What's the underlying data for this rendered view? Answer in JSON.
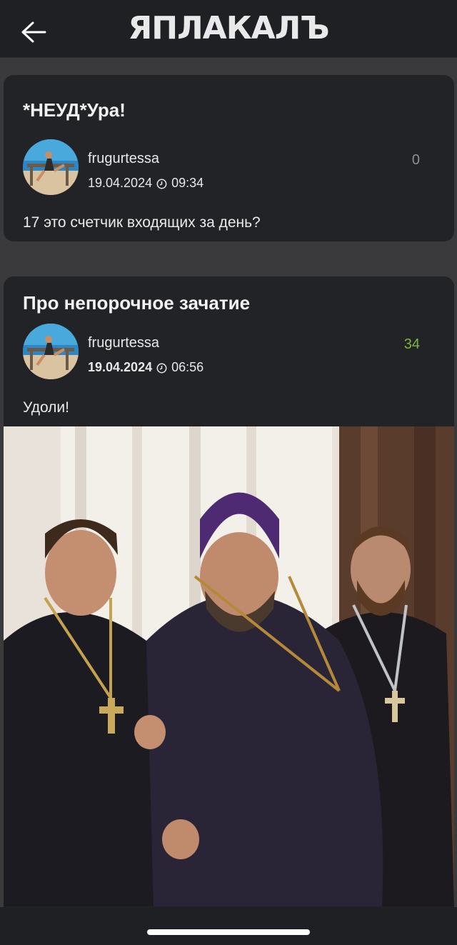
{
  "header": {
    "logo": "ЯПЛАКАЛЪ"
  },
  "posts": [
    {
      "title": "*НЕУД*Ура!",
      "author": "frugurtessa",
      "date": "19.04.2024",
      "time": "09:34",
      "score": "0",
      "text": "17 это счетчик входящих за день?"
    },
    {
      "title": "Про непорочное зачатие",
      "author": "frugurtessa",
      "date": "19.04.2024",
      "time": "06:56",
      "score": "34",
      "text": "Удоли!"
    }
  ],
  "colors": {
    "score_zero": "#8e8e93",
    "score_positive": "#7cb342",
    "background": "#3a3a3c",
    "card": "#222326"
  },
  "icons": [
    "back-arrow-icon",
    "clock-icon",
    "avatar"
  ]
}
